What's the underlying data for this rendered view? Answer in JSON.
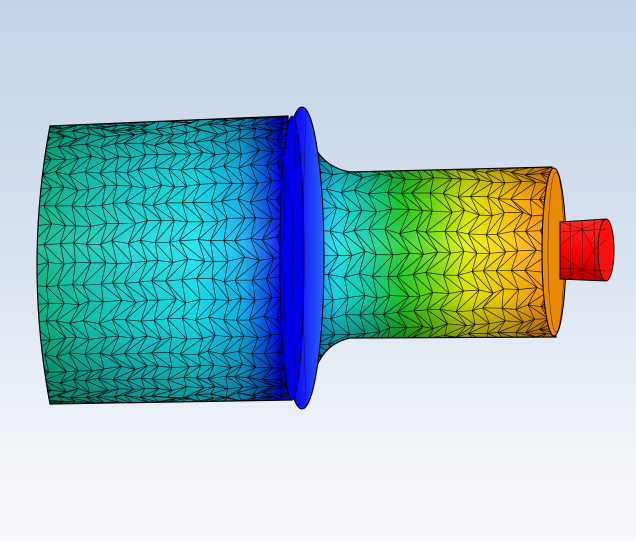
{
  "model": {
    "kind": "fem-mesh-contour",
    "colormap": [
      "#0000ff",
      "#00e5ff",
      "#00dd44",
      "#ffff00",
      "#ff8800",
      "#ff0000"
    ],
    "background": {
      "top": "#c3d3e6",
      "bottom": "#f8f9fb"
    },
    "mesh_line_color": "#000000",
    "parts": [
      {
        "id": "large-cylinder",
        "color": "cyan-green"
      },
      {
        "id": "flange-ring",
        "color": "blue"
      },
      {
        "id": "neck",
        "color": "blue-cyan"
      },
      {
        "id": "small-cylinder",
        "color": "green-yellow-orange"
      },
      {
        "id": "end-stub",
        "color": "red"
      }
    ]
  }
}
